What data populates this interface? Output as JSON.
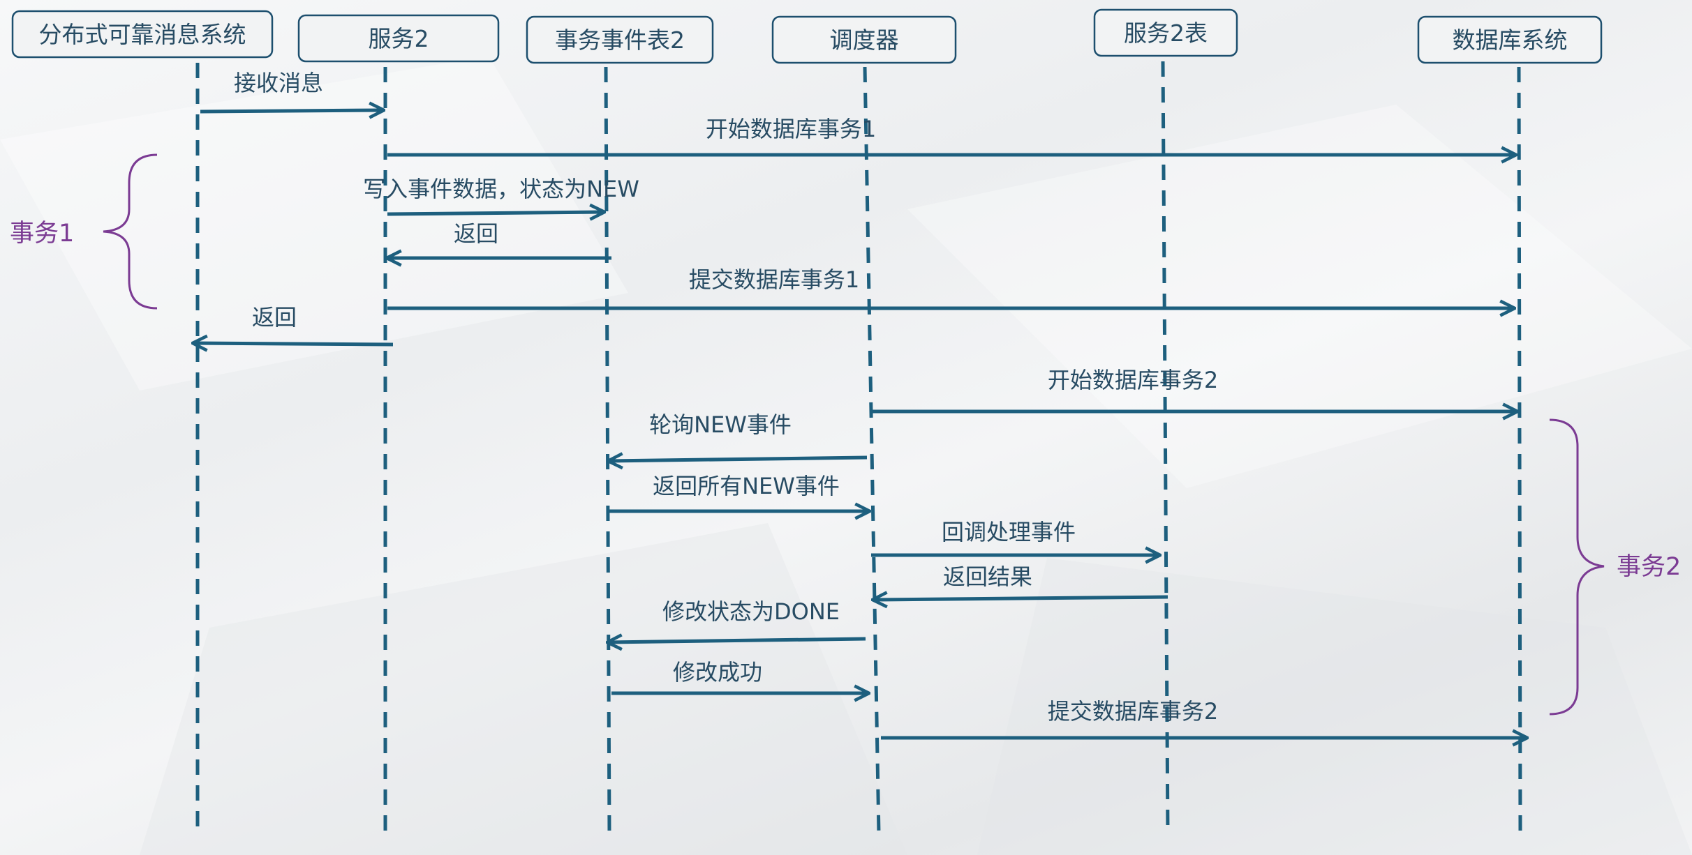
{
  "participants": [
    {
      "label": "分布式可靠消息系统"
    },
    {
      "label": "服务2"
    },
    {
      "label": "事务事件表2"
    },
    {
      "label": "调度器"
    },
    {
      "label": "服务2表"
    },
    {
      "label": "数据库系统"
    }
  ],
  "messages": [
    {
      "label": "接收消息"
    },
    {
      "label": "开始数据库事务1"
    },
    {
      "label": "写入事件数据，状态为NEW"
    },
    {
      "label": "返回"
    },
    {
      "label": "提交数据库事务1"
    },
    {
      "label": "返回"
    },
    {
      "label": "开始数据库事务2"
    },
    {
      "label": "轮询NEW事件"
    },
    {
      "label": "返回所有NEW事件"
    },
    {
      "label": "回调处理事件"
    },
    {
      "label": "返回结果"
    },
    {
      "label": "修改状态为DONE"
    },
    {
      "label": "修改成功"
    },
    {
      "label": "提交数据库事务2"
    }
  ],
  "groups": [
    {
      "label": "事务1"
    },
    {
      "label": "事务2"
    }
  ],
  "colors": {
    "lifeline": "#1d5f7e",
    "box_border": "#1d4f6e",
    "text": "#274b63",
    "brace": "#7b3b93"
  }
}
